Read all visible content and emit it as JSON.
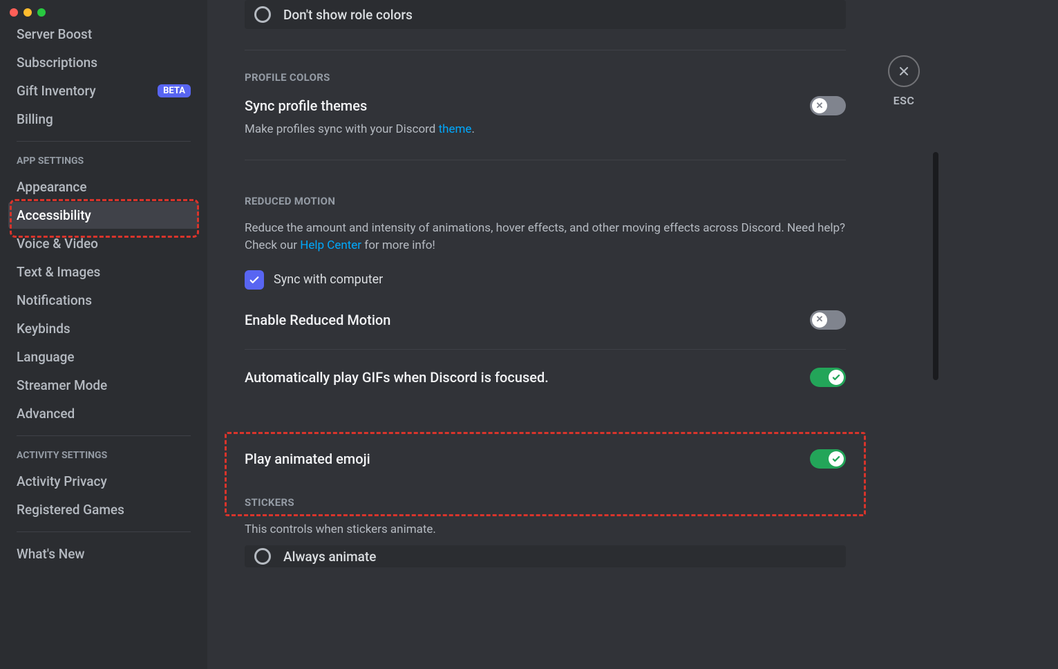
{
  "sidebar": {
    "items_top": [
      {
        "label": "Server Boost"
      },
      {
        "label": "Subscriptions"
      },
      {
        "label": "Gift Inventory",
        "badge": "BETA"
      },
      {
        "label": "Billing"
      }
    ],
    "header_app": "APP SETTINGS",
    "items_app": [
      {
        "label": "Appearance"
      },
      {
        "label": "Accessibility",
        "active": true
      },
      {
        "label": "Voice & Video"
      },
      {
        "label": "Text & Images"
      },
      {
        "label": "Notifications"
      },
      {
        "label": "Keybinds"
      },
      {
        "label": "Language"
      },
      {
        "label": "Streamer Mode"
      },
      {
        "label": "Advanced"
      }
    ],
    "header_activity": "ACTIVITY SETTINGS",
    "items_activity": [
      {
        "label": "Activity Privacy"
      },
      {
        "label": "Registered Games"
      }
    ],
    "items_bottom": [
      {
        "label": "What's New"
      }
    ]
  },
  "main": {
    "role_color_option": "Don't show role colors",
    "profile_colors": {
      "header": "PROFILE COLORS",
      "sync_title": "Sync profile themes",
      "sync_desc_prefix": "Make profiles sync with your Discord ",
      "sync_desc_link": "theme",
      "sync_desc_suffix": "."
    },
    "reduced_motion": {
      "header": "REDUCED MOTION",
      "desc_prefix": "Reduce the amount and intensity of animations, hover effects, and other moving effects across Discord. Need help? Check our ",
      "desc_link": "Help Center",
      "desc_suffix": " for more info!",
      "sync_computer": "Sync with computer",
      "enable_reduced": "Enable Reduced Motion",
      "auto_gifs": "Automatically play GIFs when Discord is focused.",
      "animated_emoji": "Play animated emoji"
    },
    "stickers": {
      "header": "STICKERS",
      "desc": "This controls when stickers animate.",
      "option": "Always animate"
    }
  },
  "close": {
    "label": "ESC"
  }
}
